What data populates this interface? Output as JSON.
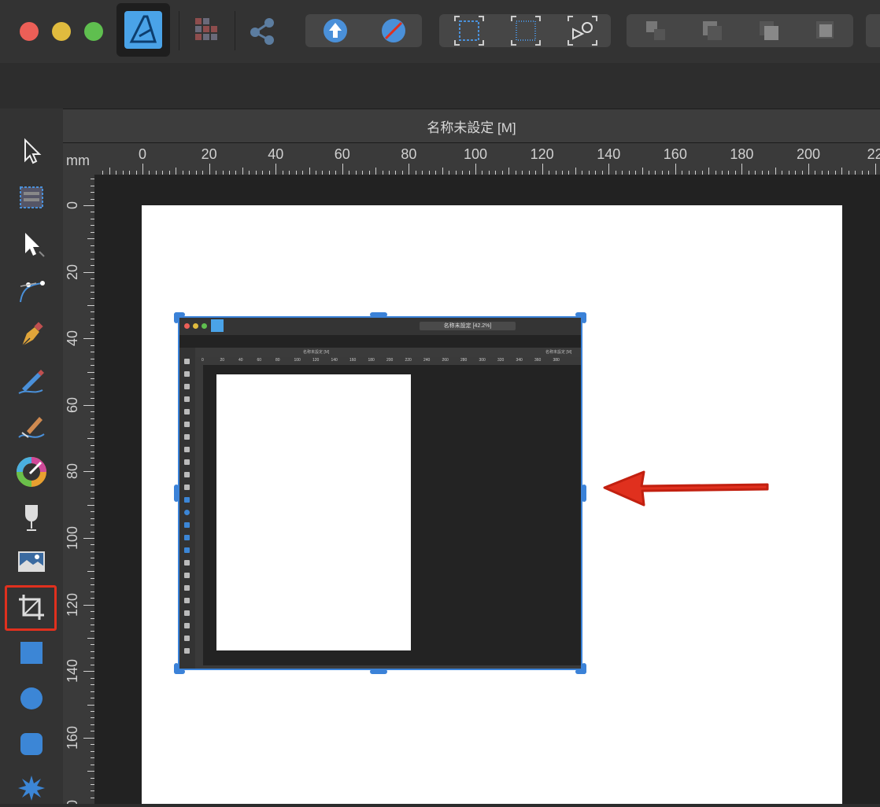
{
  "document": {
    "title": "名称未設定 [M]"
  },
  "ruler": {
    "unit": "mm",
    "horizontal_labels": [
      "0",
      "20",
      "40",
      "60",
      "80",
      "100",
      "120",
      "140",
      "160",
      "180",
      "200",
      "22"
    ],
    "vertical_labels": [
      "0",
      "20",
      "40",
      "60",
      "80",
      "100",
      "120",
      "140",
      "160",
      "0"
    ]
  },
  "embedded_screenshot": {
    "doc_title": "名称未設定 [42.2%]",
    "tab_label": "名称未設定 [M]",
    "tab_label_right": "名称未設定 [M]",
    "ruler_labels": [
      "0",
      "20",
      "40",
      "60",
      "80",
      "100",
      "120",
      "140",
      "160",
      "180",
      "200",
      "220",
      "240",
      "260",
      "280",
      "300",
      "320",
      "340",
      "360",
      "380"
    ]
  },
  "toolbar": {
    "buttons": [
      {
        "name": "close-window-button",
        "color": "#ec5f57"
      },
      {
        "name": "minimize-window-button",
        "color": "#e0bb3e"
      },
      {
        "name": "zoom-window-button",
        "color": "#5fbf4f"
      }
    ]
  },
  "tools": [
    "move-tool",
    "artboard-tool",
    "node-tool",
    "corner-tool",
    "pen-tool",
    "pencil-tool",
    "vector-brush-tool",
    "fill-tool",
    "transparency-tool",
    "place-image-tool",
    "vector-crop-tool",
    "rectangle-tool",
    "ellipse-tool",
    "rounded-rectangle-tool",
    "star-tool"
  ],
  "colors": {
    "accent": "#3b82d8",
    "highlight": "#e0301e",
    "arrow": "#e0301e"
  }
}
